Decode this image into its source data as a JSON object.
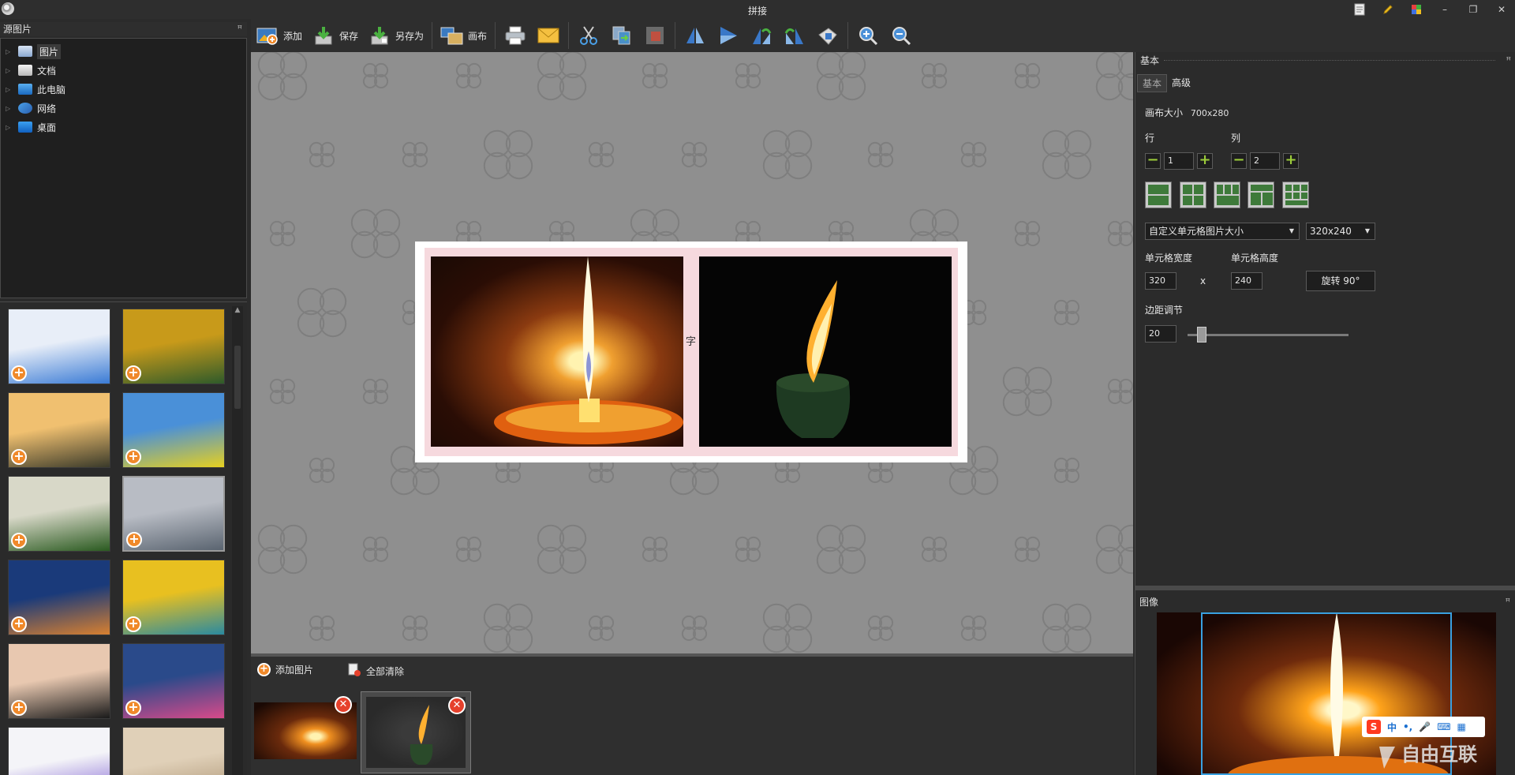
{
  "window": {
    "title": "拼接"
  },
  "titlebar_icons": [
    "document-icon",
    "pencil-icon",
    "palette-icon",
    "minimize-icon",
    "restore-icon",
    "close-icon"
  ],
  "titlebar_glyphs": {
    "minimize": "–",
    "restore": "❐",
    "close": "✕"
  },
  "source_panel": {
    "title": "源图片",
    "pin": "ꟸ",
    "tree": [
      {
        "label": "图片",
        "icon": "pictures-folder-icon",
        "selected": true
      },
      {
        "label": "文档",
        "icon": "documents-folder-icon"
      },
      {
        "label": "此电脑",
        "icon": "computer-icon"
      },
      {
        "label": "网络",
        "icon": "network-icon"
      },
      {
        "label": "桌面",
        "icon": "desktop-icon"
      }
    ]
  },
  "thumbnails": [
    {
      "name": "thumb-screenshot-1",
      "colors": [
        "#e8eef8",
        "#3a7bd5"
      ]
    },
    {
      "name": "thumb-autumn-road",
      "colors": [
        "#c89a1a",
        "#2e5a2a"
      ]
    },
    {
      "name": "thumb-castle-sunset",
      "colors": [
        "#f0c070",
        "#3a3a2a"
      ]
    },
    {
      "name": "thumb-green-field-tree",
      "colors": [
        "#4a90d8",
        "#e6d020"
      ]
    },
    {
      "name": "thumb-misty-forest",
      "colors": [
        "#d8d8c8",
        "#2a5a20"
      ]
    },
    {
      "name": "thumb-river-fisherman",
      "colors": [
        "#b8bcc4",
        "#5a6470"
      ],
      "selected": true
    },
    {
      "name": "thumb-city-bridge-night",
      "colors": [
        "#1a3a7a",
        "#d88030"
      ]
    },
    {
      "name": "thumb-rice-terraces",
      "colors": [
        "#e8c020",
        "#2a8aa0"
      ]
    },
    {
      "name": "thumb-girl-portrait",
      "colors": [
        "#e8c8b0",
        "#1a1a1a"
      ]
    },
    {
      "name": "thumb-app-tiles",
      "colors": [
        "#2a4a8a",
        "#d84a8a"
      ]
    },
    {
      "name": "thumb-screenshot-2",
      "colors": [
        "#f4f4f8",
        "#7a5ad0"
      ]
    },
    {
      "name": "thumb-sand-dunes",
      "colors": [
        "#e0d0b8",
        "#a89070"
      ]
    }
  ],
  "toolbar": {
    "add": "添加",
    "save": "保存",
    "save_as": "另存为",
    "canvas": "画布"
  },
  "canvas": {
    "midtext": "字",
    "background_color": "#8f8f8f",
    "frame_color": "#f6d9de"
  },
  "strip": {
    "add_image": "添加图片",
    "clear_all": "全部清除"
  },
  "props": {
    "header": "基本",
    "tabs": [
      "基本",
      "高级"
    ],
    "canvas_size_label": "画布大小",
    "canvas_size_value": "700x280",
    "rows_label": "行",
    "cols_label": "列",
    "rows_value": "1",
    "cols_value": "2",
    "minus": "−",
    "plus": "+",
    "cell_size_mode": "自定义单元格图片大小",
    "cell_size_preset": "320x240",
    "cell_width_label": "单元格宽度",
    "cell_height_label": "单元格高度",
    "cell_width": "320",
    "cell_height": "240",
    "times": "x",
    "rotate": "旋转 90°",
    "margin_label": "边距调节",
    "margin_value": "20",
    "margin_slider_position": 0.09
  },
  "image_panel": {
    "title": "图像"
  },
  "ime": {
    "logo": "S",
    "mode": "中",
    "punct": "•,",
    "items": [
      "mic-icon",
      "keyboard-icon",
      "grid-icon"
    ]
  },
  "watermark": {
    "brand": "自由互联"
  },
  "colors": {
    "accent": "#f0892a",
    "delete": "#e6412c",
    "plus_green": "#9ccc3a",
    "selection": "#39a0e0"
  }
}
